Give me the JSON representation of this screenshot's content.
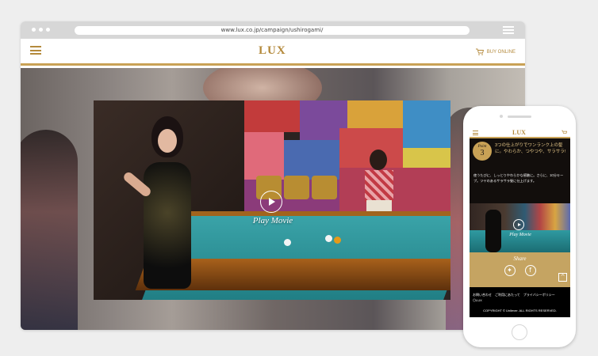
{
  "browser": {
    "url": "www.lux.co.jp/campaign/ushirogami/"
  },
  "site": {
    "logo": "LUX",
    "buy_label": "BUY ONLINE"
  },
  "video": {
    "play_label": "Play Movie"
  },
  "phone": {
    "logo": "LUX",
    "point_word": "Point",
    "point_number": "3",
    "point_text": "3つの仕上がりでワンランク上の髪に。やわらか、つやつや、サラサラ!",
    "body_text": "使うたびに、しっとりやわらかな感触に。さらに、10分キープ。ツヤのあるサラサラ髪に仕上げます。",
    "play_label": "Play Movie",
    "share_title": "Share",
    "footer_links": "お問い合わせ　ご利用にあたって　プライバシーポリシー　◎LUX",
    "copyright": "COPYRIGHT © Unilever. ALL RIGHTS RESERVED."
  },
  "colors": {
    "gold": "#c9a256",
    "background": "#eeeeee"
  }
}
